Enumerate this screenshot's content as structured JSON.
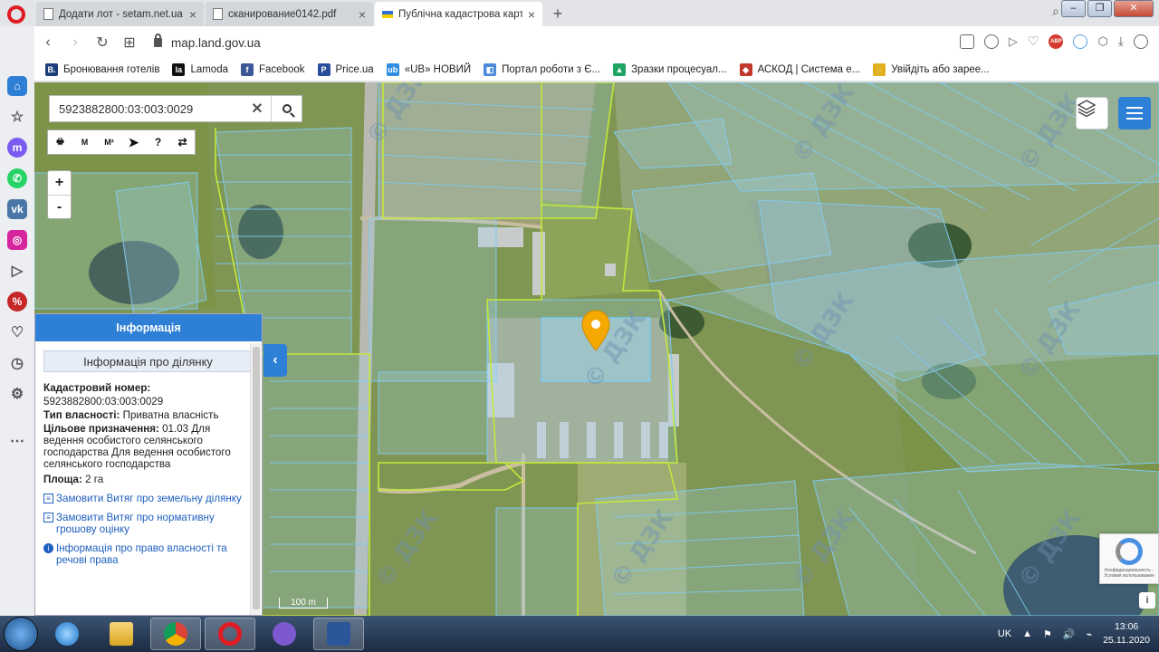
{
  "browser": {
    "tabs": [
      {
        "title": "Додати лот - setam.net.ua",
        "active": false
      },
      {
        "title": "сканирование0142.pdf",
        "active": false
      },
      {
        "title": "Публічна кадастрова карт",
        "active": true
      }
    ],
    "new_tab": "+",
    "url": "map.land.gov.ua",
    "bookmarks": [
      {
        "label": "Бронювання готелів",
        "icon": "B.",
        "color": "#1d3e7a"
      },
      {
        "label": "Lamoda",
        "icon": "la",
        "color": "#111111"
      },
      {
        "label": "Facebook",
        "icon": "f",
        "color": "#3b5998"
      },
      {
        "label": "Price.ua",
        "icon": "P",
        "color": "#2a4d9b"
      },
      {
        "label": "«UB» НОВИЙ",
        "icon": "ub",
        "color": "#2f8ee0"
      },
      {
        "label": "Портал роботи з Є...",
        "icon": "◧",
        "color": "#4a8ad8"
      },
      {
        "label": "Зразки процесуал...",
        "icon": "▲",
        "color": "#1fa463"
      },
      {
        "label": "АСКОД | Система е...",
        "icon": "◆",
        "color": "#c0392b"
      },
      {
        "label": "Увійдіть або зарее...",
        "icon": "◌",
        "color": "#e0b020"
      }
    ]
  },
  "map": {
    "search": {
      "value": "5923882800:03:003:0029"
    },
    "zoom_in": "+",
    "zoom_out": "-",
    "scale_label": "100 m",
    "watermark": "© ДЗК",
    "tools": [
      "print-icon",
      "measure-length-icon",
      "measure-area-icon",
      "pointer-icon",
      "info-query-icon",
      "route-icon"
    ],
    "tool_marks": {
      "length": "M",
      "area": "M²"
    }
  },
  "info_panel": {
    "title": "Інформація",
    "subtitle": "Інформація про ділянку",
    "cadastral_label": "Кадастровий номер:",
    "cadastral_value": "5923882800:03:003:0029",
    "ownership_label": "Тип власності:",
    "ownership_value": "Приватна власність",
    "purpose_label": "Цільове призначення:",
    "purpose_value": "01.03 Для ведення особистого селянського господарства Для ведення особистого селянського господарства",
    "area_label": "Площа:",
    "area_value": "2 га",
    "links": [
      {
        "label": "Замовити Витяг про земельну ділянку",
        "icon": "document-icon"
      },
      {
        "label": "Замовити Витяг про нормативну грошову оцінку",
        "icon": "document-icon"
      },
      {
        "label": "Інформація про право власності та речові права",
        "icon": "info-icon"
      }
    ]
  },
  "recaptcha": {
    "text": "Конфиденциальность - Условия использования"
  },
  "taskbar": {
    "language": "UK",
    "time": "13:06",
    "date": "25.11.2020"
  },
  "colors": {
    "accent": "#2e7fd6",
    "marker": "#f5a800",
    "parcel_line": "#7fc9ef",
    "highlight_line": "#c4e83a"
  }
}
